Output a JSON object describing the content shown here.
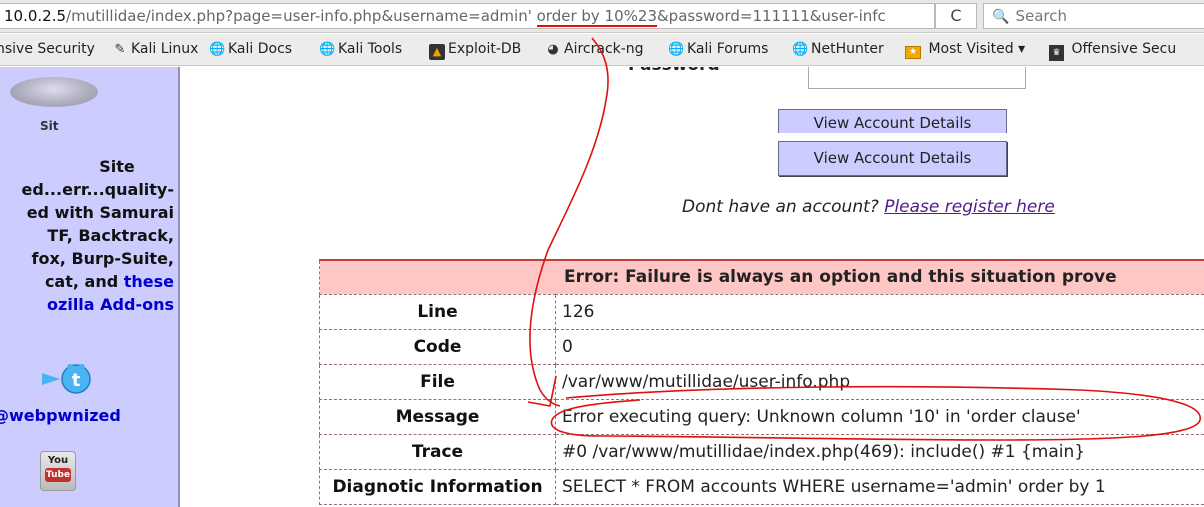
{
  "browser": {
    "url_host": "10.0.2.5",
    "url_path": "/mutillidae/index.php?page=user-info.php&username=admin'",
    "url_injection": "order by 10%23",
    "url_rest": "&password=111111&user-infc",
    "reload_glyph": "C",
    "search_placeholder": "Search"
  },
  "bookmarks": [
    {
      "label": "nsive Security",
      "icon": "offensive-security-icon"
    },
    {
      "label": "Kali Linux",
      "icon": "kali-dragon-icon"
    },
    {
      "label": "Kali Docs",
      "icon": "globe-icon"
    },
    {
      "label": "Kali Tools",
      "icon": "globe-icon"
    },
    {
      "label": "Exploit-DB",
      "icon": "exploit-db-icon"
    },
    {
      "label": "Aircrack-ng",
      "icon": "aircrack-icon"
    },
    {
      "label": "Kali Forums",
      "icon": "globe-icon"
    },
    {
      "label": "NetHunter",
      "icon": "globe-icon"
    },
    {
      "label": "Most Visited ▾",
      "icon": "folder-icon"
    },
    {
      "label": "Offensive Secu",
      "icon": "offensive-security-icon"
    }
  ],
  "sidebar": {
    "logo_caption": "Sit",
    "title": "Site",
    "lines": [
      "ed...err...quality-",
      "ed with Samurai",
      "TF, Backtrack,",
      "fox, Burp-Suite,"
    ],
    "line5_prefix": "cat, and ",
    "line5_link": "these",
    "line6_link": "ozilla Add-ons",
    "twitter_handle": "@webpwnized",
    "youtube_top": "You",
    "youtube_bottom": "Tube"
  },
  "login": {
    "password_label": "Password",
    "view_button": "View Account Details",
    "register_prompt": "Dont have an account?",
    "register_link": "Please register here"
  },
  "error": {
    "header": "Error: Failure is always an option and this situation prove",
    "rows": [
      {
        "key": "Line",
        "value": "126"
      },
      {
        "key": "Code",
        "value": "0"
      },
      {
        "key": "File",
        "value": "/var/www/mutillidae/user-info.php"
      },
      {
        "key": "Message",
        "value": "Error executing query: Unknown column '10' in 'order clause'"
      },
      {
        "key": "Trace",
        "value": "#0 /var/www/mutillidae/index.php(469): include() #1 {main}"
      },
      {
        "key": "Diagnotic Information",
        "value": "SELECT * FROM accounts WHERE username='admin' order by 1"
      }
    ]
  },
  "colors": {
    "sidebar_bg": "#ccccff",
    "error_header_bg": "#ffc6c6",
    "annotation_red": "#e01010",
    "link_blue": "#0000cc"
  }
}
